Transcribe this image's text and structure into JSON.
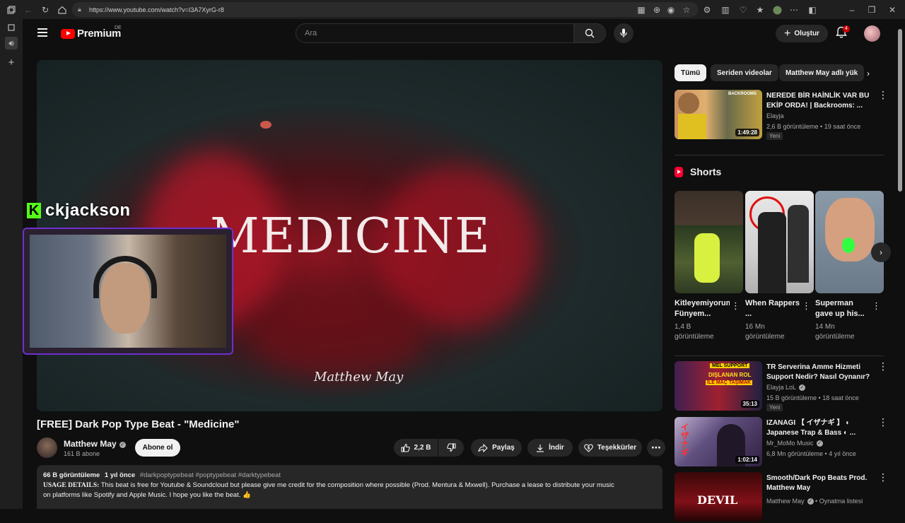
{
  "browser": {
    "url": "https://www.youtube.com/watch?v=I3A7XyrG-r8"
  },
  "header": {
    "logo_text": "Premium",
    "region": "DE",
    "search_placeholder": "Ara",
    "create_label": "Oluştur",
    "notification_count": "4"
  },
  "player": {
    "overlay_title": "MEDICINE",
    "signature": "Matthew May"
  },
  "stream_overlay": {
    "streamer_name": "ckjackson",
    "badge_letter": "K"
  },
  "video": {
    "title": "[FREE] Dark Pop Type Beat - \"Medicine\"",
    "channel_name": "Matthew May",
    "subscribers": "161 B abone",
    "subscribe_label": "Abone ol",
    "likes": "2,2 B",
    "share_label": "Paylaş",
    "download_label": "İndir",
    "thanks_label": "Teşekkürler"
  },
  "description": {
    "views": "66 B görüntüleme",
    "age": "1 yıl önce",
    "tags": "#darkpoptypebeat #poptypebeat #darktypebeat",
    "usage_heading": "USAGE DETAILS:",
    "text_line1": "This beat is free for Youtube & Soundcloud but please give me credit for the composition where possible (Prod. Mentura & Mxwell). Purchase a lease to distribute your music",
    "text_line2": "on platforms like Spotify and Apple Music. I hope you like the beat. 👍"
  },
  "chips": [
    {
      "label": "Tümü"
    },
    {
      "label": "Seriden videolar"
    },
    {
      "label": "Matthew May adlı yük"
    }
  ],
  "recommendations": [
    {
      "title": "NEREDE BİR HAİNLİK VAR BU EKİP ORDA! | Backrooms: ...",
      "channel": "Elayja",
      "meta": "2,6 B görüntüleme • 19 saat önce",
      "badge": "Yeni",
      "duration": "1:49:28",
      "thumb_text": "BACKROOMS"
    },
    {
      "title": "TR Serverina Amme Hizmeti Support Nedir? Nasıl Oynanır? ...",
      "channel": "Elayja LoL",
      "meta": "15 B görüntüleme • 18 saat önce",
      "badge": "Yeni",
      "duration": "35:13",
      "thumb_text1": "MEL SUPPORT",
      "thumb_text2": "DIŞLANAN ROL",
      "thumb_text3": "İLE MAÇ TAŞIMAK"
    },
    {
      "title": "IZANAGI 【 イザナギ 】 ◐ Japanese Trap & Bass ◐ ...",
      "channel": "Mr_MoMo Music",
      "meta": "6,8 Mn görüntüleme • 4 yıl önce",
      "duration": "1:02:14",
      "thumb_text": "イザナギ"
    },
    {
      "title": "Smooth/Dark Pop Beats Prod. Matthew May",
      "channel": "Matthew May",
      "meta": "Oynatma listesi",
      "thumb_text": "DEVIL"
    }
  ],
  "shorts": {
    "heading": "Shorts",
    "items": [
      {
        "title": "Kitleyemiyorum Fünyem...",
        "views": "1,4 B görüntüleme"
      },
      {
        "title": "When Rappers ...",
        "views": "16 Mn görüntüleme"
      },
      {
        "title": "Superman gave up his...",
        "views": "14 Mn görüntüleme"
      }
    ]
  },
  "colors": {
    "background": "#0f0f0f",
    "brand_red": "#ff0000",
    "kick_green": "#53fc18",
    "webcam_border": "#6e2fd0"
  }
}
